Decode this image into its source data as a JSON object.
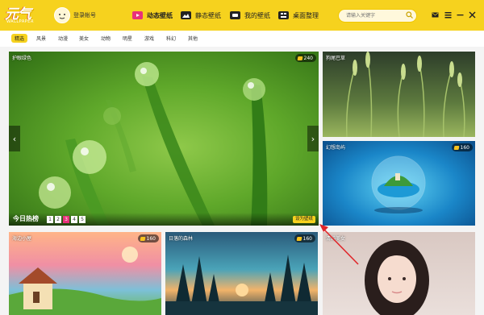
{
  "brand": {
    "logo_text": "元气",
    "logo_sub": "WALLPAPER",
    "accent": "#f6d21e"
  },
  "user": {
    "login_label": "登录帐号"
  },
  "nav": [
    {
      "label": "动态壁纸",
      "icon": "video-icon",
      "active": true
    },
    {
      "label": "静态壁纸",
      "icon": "image-icon"
    },
    {
      "label": "我的壁纸",
      "icon": "gamepad-icon"
    },
    {
      "label": "桌面整理",
      "icon": "desktop-organize-icon"
    }
  ],
  "search": {
    "placeholder": "请输入关键字"
  },
  "categories": [
    "精选",
    "风景",
    "动漫",
    "美女",
    "动物",
    "明星",
    "游戏",
    "科幻",
    "其他"
  ],
  "featured": {
    "title": "护眼绿色",
    "price": "240",
    "hot_label": "今日热榜",
    "pages": [
      "1",
      "2",
      "3",
      "4",
      "5"
    ],
    "active_page": "3",
    "set_label": "设为壁纸",
    "prev_icon": "chevron-left-icon",
    "next_icon": "chevron-right-icon"
  },
  "side_cards": [
    {
      "title": "狗尾巴草"
    },
    {
      "title": "幻想岛屿",
      "price": "160"
    }
  ],
  "bottom_cards": [
    {
      "title": "海边小屋",
      "price": "160"
    },
    {
      "title": "日落的森林",
      "price": "160"
    },
    {
      "title": "清纯美女"
    }
  ]
}
